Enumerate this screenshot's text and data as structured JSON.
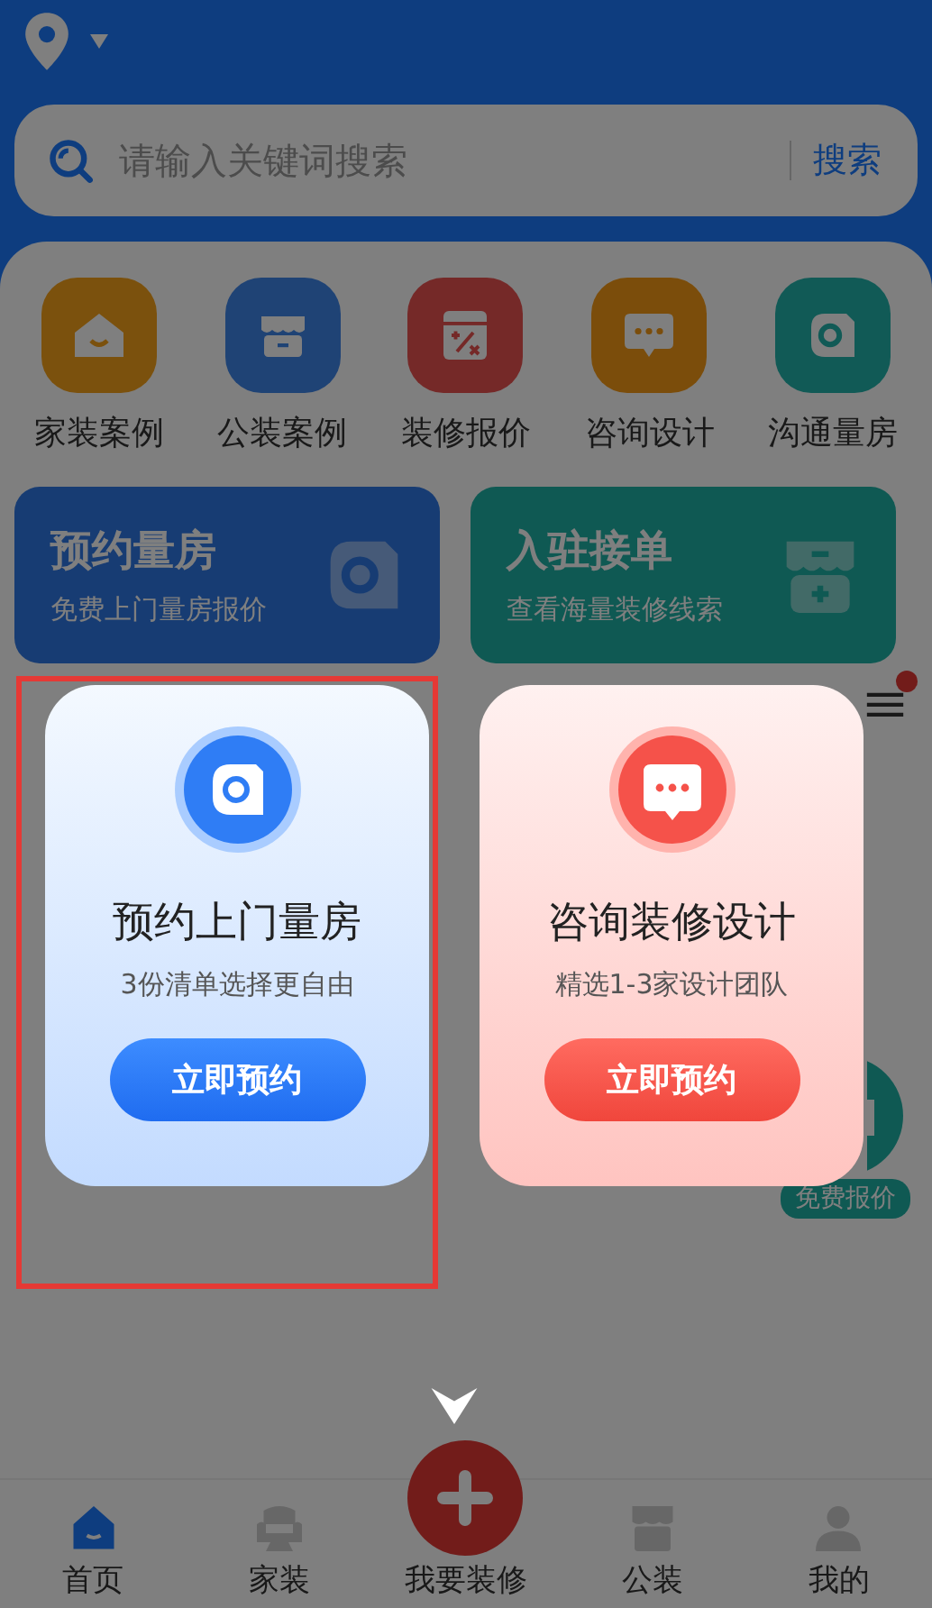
{
  "search": {
    "placeholder": "请输入关键词搜索",
    "button": "搜索"
  },
  "shortcuts": [
    {
      "label": "家装案例",
      "kind": "house"
    },
    {
      "label": "公装案例",
      "kind": "store"
    },
    {
      "label": "装修报价",
      "kind": "calc"
    },
    {
      "label": "咨询设计",
      "kind": "chat"
    },
    {
      "label": "沟通量房",
      "kind": "tape"
    }
  ],
  "banners": [
    {
      "title": "预约量房",
      "subtitle": "免费上门量房报价",
      "kind": "tape"
    },
    {
      "title": "入驻接单",
      "subtitle": "查看海量装修线索",
      "kind": "store"
    }
  ],
  "menu": {
    "badge": true
  },
  "floating_badge": {
    "label": "免费报价"
  },
  "popup": {
    "cards": [
      {
        "kind": "tape",
        "title": "预约上门量房",
        "subtitle": "3份清单选择更自由",
        "button": "立即预约",
        "highlighted": true
      },
      {
        "kind": "chat",
        "title": "咨询装修设计",
        "subtitle": "精选1-3家设计团队",
        "button": "立即预约",
        "highlighted": false
      }
    ]
  },
  "nav": [
    {
      "label": "首页",
      "kind": "home",
      "selected": true
    },
    {
      "label": "家装",
      "kind": "sofa",
      "selected": false
    },
    {
      "label": "我要装修",
      "kind": "add",
      "selected": false
    },
    {
      "label": "公装",
      "kind": "store",
      "selected": false
    },
    {
      "label": "我的",
      "kind": "user",
      "selected": false
    }
  ]
}
